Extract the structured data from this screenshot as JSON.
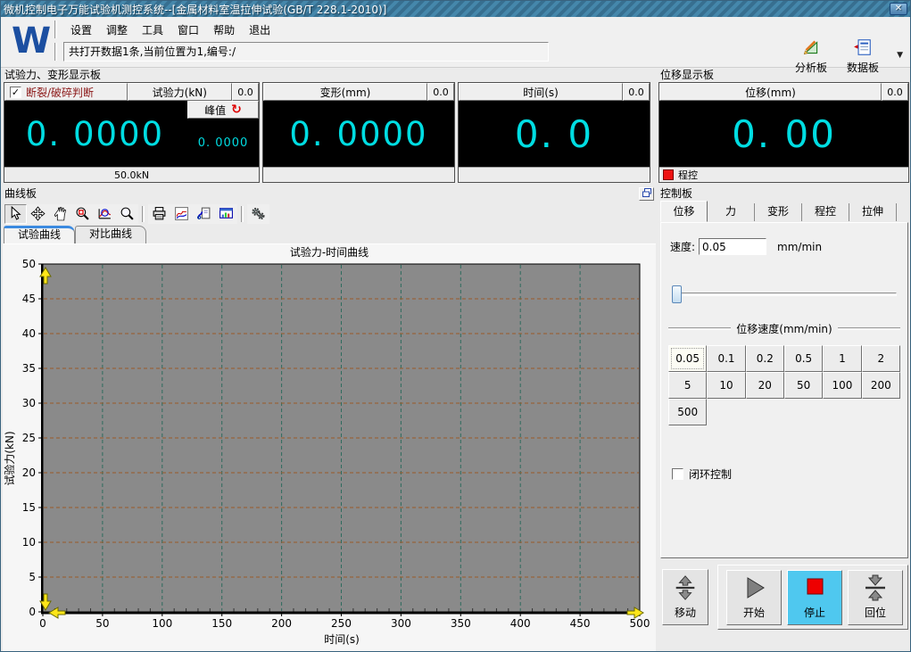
{
  "window": {
    "title": "微机控制电子万能试验机测控系统--[金属材料室温拉伸试验(GB/T 228.1-2010)]",
    "close_glyph": "✕"
  },
  "branding": {
    "logo_text": "W"
  },
  "menu": {
    "items": [
      "设置",
      "调整",
      "工具",
      "窗口",
      "帮助",
      "退出"
    ]
  },
  "statusbar": {
    "text": "共打开数据1条,当前位置为1,编号:/"
  },
  "top_toolbar": {
    "analysis_label": "分析板",
    "data_label": "数据板",
    "more_glyph": "▼"
  },
  "force_panel": {
    "title": "试验力、变形显示板",
    "break_label": "断裂/破碎判断",
    "break_checked": true,
    "check_glyph": "✓",
    "force": {
      "header": "试验力(kN)",
      "header_value": "0.0",
      "value": "0. 0000",
      "peak_label": "峰值",
      "peak_glyph": "↻",
      "peak_value": "0. 0000",
      "footer": "50.0kN"
    },
    "deform": {
      "header": "变形(mm)",
      "header_value": "0.0",
      "value": "0. 0000",
      "footer": ""
    },
    "time": {
      "header": "时间(s)",
      "header_value": "0.0",
      "value": "0. 0",
      "footer": ""
    }
  },
  "displacement_panel": {
    "title": "位移显示板",
    "header": "位移(mm)",
    "header_value": "0.0",
    "value": "0. 00",
    "mode_label": "程控"
  },
  "curve_panel": {
    "title": "曲线板",
    "tabs": [
      {
        "label": "试验曲线",
        "active": true
      },
      {
        "label": "对比曲线",
        "active": false
      }
    ],
    "toolbar": [
      {
        "name": "select-cursor-icon",
        "pressed": true
      },
      {
        "name": "move-cross-icon"
      },
      {
        "name": "pan-hand-icon"
      },
      {
        "name": "zoom-box-icon"
      },
      {
        "name": "zoom-curve-icon"
      },
      {
        "name": "magnifier-icon"
      },
      {
        "name": "print-icon",
        "sep_before": true
      },
      {
        "name": "curve-style-icon"
      },
      {
        "name": "curve-copy-icon"
      },
      {
        "name": "data-window-icon"
      },
      {
        "name": "gears-icon",
        "sep_before": true
      }
    ]
  },
  "chart_data": {
    "type": "line",
    "title": "试验力-时间曲线",
    "xlabel": "时间(s)",
    "ylabel": "试验力(kN)",
    "xlim": [
      0,
      500
    ],
    "ylim": [
      0,
      50
    ],
    "xticks": [
      0,
      50,
      100,
      150,
      200,
      250,
      300,
      350,
      400,
      450,
      500
    ],
    "yticks": [
      0,
      5,
      10,
      15,
      20,
      25,
      30,
      35,
      40,
      45,
      50
    ],
    "x_minor_step": 10,
    "grid": true,
    "legend": false,
    "series": [
      {
        "name": "试验力-时间",
        "x": [],
        "y": []
      }
    ],
    "colors": {
      "plot_bg": "#8a8a8a",
      "hgrid": "#9b5a28",
      "vgrid": "#2e6b5e",
      "axis": "#000000",
      "limit_marker": "#ffe619"
    }
  },
  "control_panel": {
    "title": "控制板",
    "tabs": [
      {
        "label": "位移",
        "active": true
      },
      {
        "label": "力",
        "active": false
      },
      {
        "label": "变形",
        "active": false
      },
      {
        "label": "程控",
        "active": false
      },
      {
        "label": "拉伸",
        "active": false
      }
    ],
    "speed": {
      "label": "速度:",
      "value": "0.05",
      "unit": "mm/min"
    },
    "slider": {
      "thumb_percent": 0
    },
    "speed_group": {
      "title": "位移速度(mm/min)",
      "options": [
        "0.05",
        "0.1",
        "0.2",
        "0.5",
        "1",
        "2",
        "5",
        "10",
        "20",
        "50",
        "100",
        "200",
        "500"
      ],
      "selected": "0.05"
    },
    "closed_loop": {
      "label": "闭环控制",
      "checked": false
    },
    "motion": {
      "move": "移动",
      "start": "开始",
      "stop": "停止",
      "return": "回位"
    }
  }
}
